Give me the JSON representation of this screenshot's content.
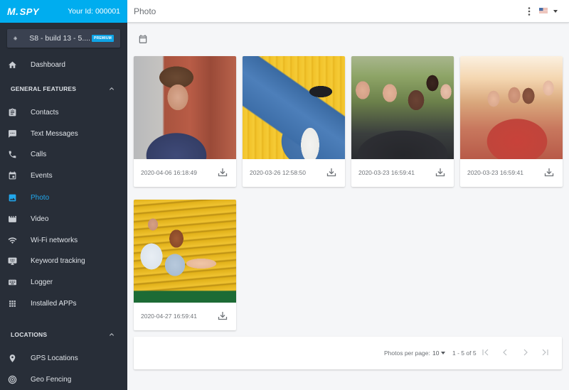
{
  "brand": {
    "logo_mark": "M.",
    "logo_text": "SPY",
    "user_id": "Your Id: 000001"
  },
  "device": {
    "name": "S8 - build 13 - 5....",
    "badge": "PREMIUM"
  },
  "sidebar": {
    "dashboard": {
      "label": "Dashboard",
      "icon": "home-icon"
    },
    "sections": [
      {
        "title": "GENERAL FEATURES",
        "expanded": true,
        "items": [
          {
            "label": "Contacts",
            "icon": "clipboard-icon"
          },
          {
            "label": "Text Messages",
            "icon": "message-icon"
          },
          {
            "label": "Calls",
            "icon": "phone-icon"
          },
          {
            "label": "Events",
            "icon": "calendar-icon"
          },
          {
            "label": "Photo",
            "icon": "image-icon",
            "active": true
          },
          {
            "label": "Video",
            "icon": "movie-icon"
          },
          {
            "label": "Wi-Fi networks",
            "icon": "wifi-icon"
          },
          {
            "label": "Keyword tracking",
            "icon": "keyboard-monitor-icon"
          },
          {
            "label": "Logger",
            "icon": "keyboard-icon"
          },
          {
            "label": "Installed APPs",
            "icon": "apps-grid-icon"
          }
        ]
      },
      {
        "title": "LOCATIONS",
        "expanded": true,
        "items": [
          {
            "label": "GPS Locations",
            "icon": "location-pin-icon"
          },
          {
            "label": "Geo Fencing",
            "icon": "target-icon"
          }
        ]
      }
    ]
  },
  "header": {
    "title": "Photo",
    "language_flag": "us-flag-icon"
  },
  "photos": [
    {
      "date": "2020-04-06 16:18:49",
      "subject": "young man in hoodie by brick wall"
    },
    {
      "date": "2020-03-26 12:58:50",
      "subject": "man in denim jacket dabbing against yellow wall"
    },
    {
      "date": "2020-03-23 16:59:41",
      "subject": "group selfie of friends in park"
    },
    {
      "date": "2020-03-23 16:59:41",
      "subject": "group selfie of friends in sunlight"
    },
    {
      "date": "2020-04-27 16:59:41",
      "subject": "couple sitting on yellow bleachers"
    }
  ],
  "pagination": {
    "per_page_label": "Photos per page:",
    "per_page_value": "10",
    "range": "1 - 5 of 5"
  },
  "colors": {
    "brand": "#00adef",
    "sidebar_bg": "#282e38",
    "active": "#21a7ec"
  }
}
